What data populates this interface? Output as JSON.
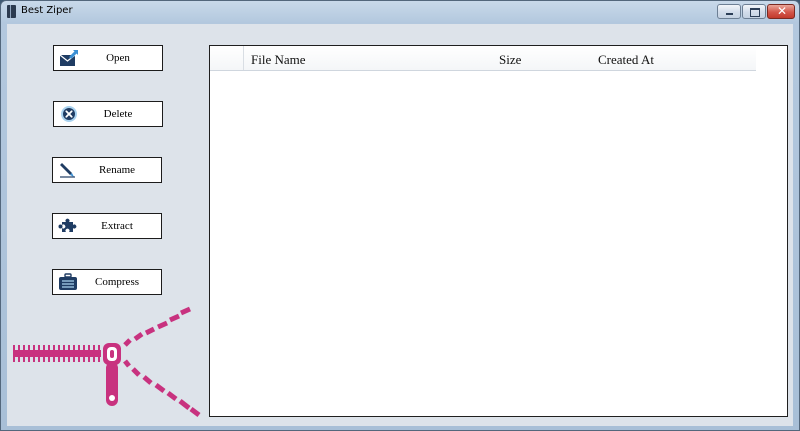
{
  "window": {
    "title": "Best Ziper",
    "controls": {
      "minimize": "minimize",
      "maximize": "maximize",
      "close": "✕"
    }
  },
  "actions": [
    {
      "id": "open",
      "label": "Open",
      "icon": "envelope-arrow-icon"
    },
    {
      "id": "delete",
      "label": "Delete",
      "icon": "delete-circle-icon"
    },
    {
      "id": "rename",
      "label": "Rename",
      "icon": "pencil-icon"
    },
    {
      "id": "extract",
      "label": "Extract",
      "icon": "puzzle-icon"
    },
    {
      "id": "compress",
      "label": "Compress",
      "icon": "archive-box-icon"
    }
  ],
  "file_list": {
    "columns": [
      "File Name",
      "Size",
      "Created At"
    ],
    "rows": []
  },
  "colors": {
    "zipper": "#c8327f",
    "client_bg": "#dde3ea",
    "icon_dark": "#1f3c63",
    "icon_accent": "#3a8fd4"
  }
}
